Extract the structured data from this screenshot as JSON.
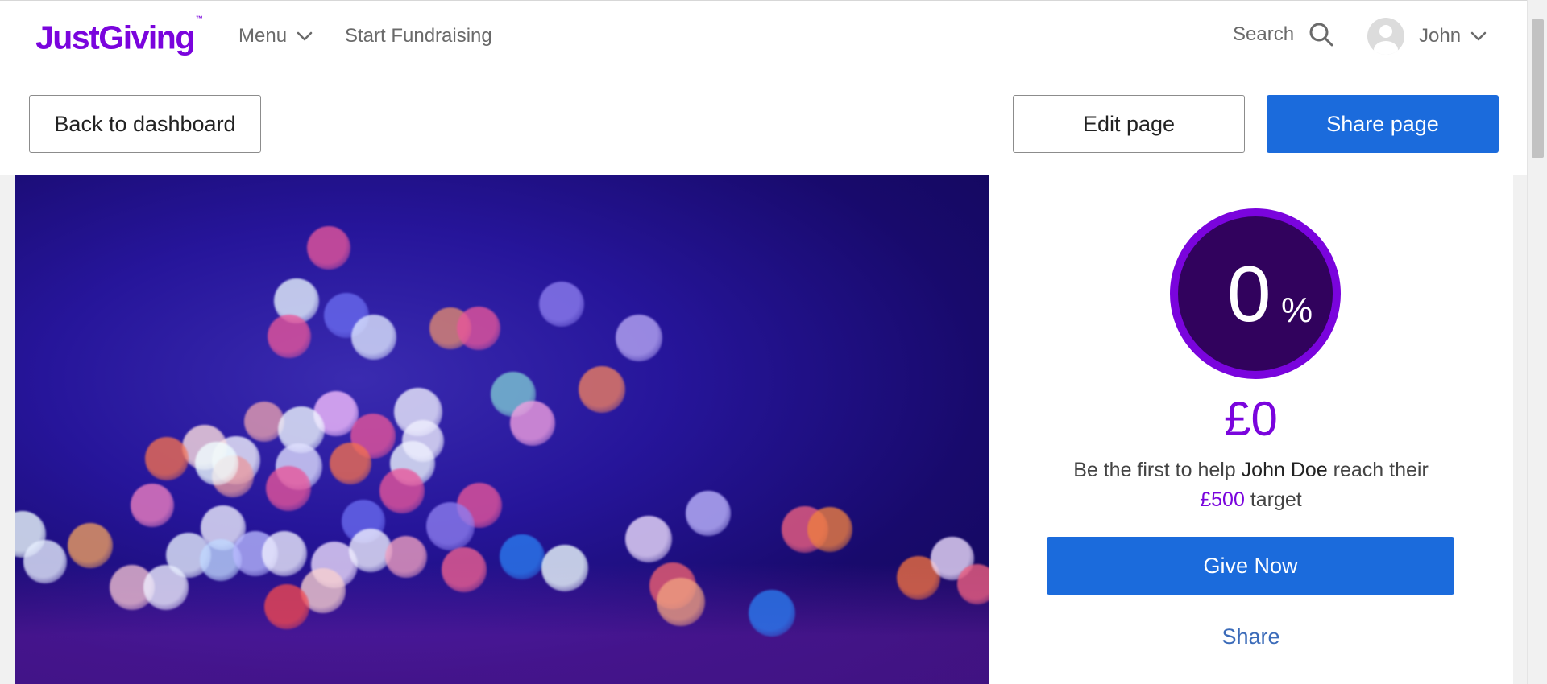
{
  "header": {
    "logo_text": "JustGiving",
    "logo_tm": "™",
    "menu_label": "Menu",
    "start_fundraising_label": "Start Fundraising",
    "search_label": "Search",
    "user_name": "John"
  },
  "actions": {
    "back_label": "Back to dashboard",
    "edit_label": "Edit page",
    "share_label": "Share page"
  },
  "progress": {
    "percent_value": "0",
    "percent_sign": "%",
    "percent": 0,
    "raised": "£0",
    "help_prefix": "Be the first to help",
    "fundraiser_name": "John Doe",
    "help_middle": "reach their",
    "target": "£500",
    "help_suffix": "target"
  },
  "give_now_label": "Give Now",
  "share_link_label": "Share",
  "colors": {
    "brand_purple": "#7a04dd",
    "primary_blue": "#1b6bdc",
    "ring_fill": "#31025d",
    "link_blue": "#3b6bb9"
  },
  "icons": [
    "chevron-down-icon",
    "search-icon",
    "user-avatar-icon"
  ]
}
